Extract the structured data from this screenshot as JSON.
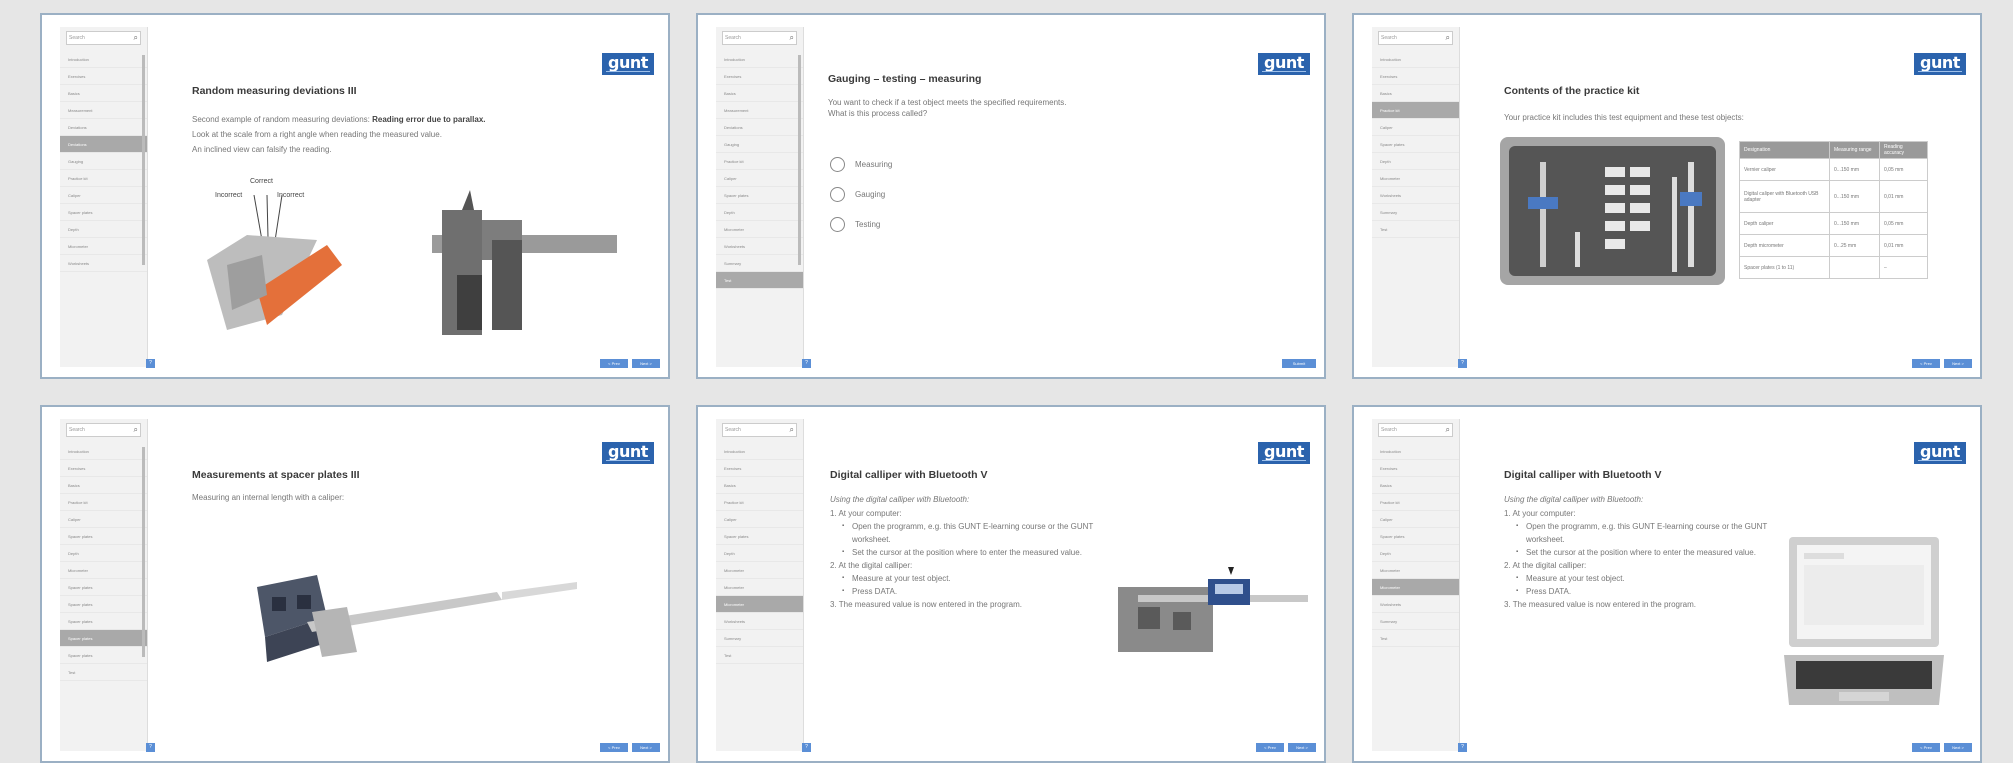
{
  "nav": {
    "search_placeholder": "Search",
    "items": [
      "Introduction",
      "Exercises",
      "Basics",
      "Measurement",
      "Deviations",
      "Gauging",
      "Practice kit",
      "Caliper",
      "Spacer plates",
      "Depth",
      "Micrometer",
      "Worksheets",
      "Summary",
      "Test"
    ]
  },
  "buttons": {
    "prev": "< Prev",
    "next": "Next >",
    "submit": "Submit",
    "help": "?"
  },
  "brand": "gunt",
  "panel1": {
    "title": "Random measuring deviations III",
    "line1_plain": "Second example of random measuring deviations:",
    "line1_bold": "Reading error due to parallax.",
    "line2": "Look at the scale from a right angle when reading the measured value.",
    "line3": "An inclined view can falsify the reading.",
    "label_correct": "Correct",
    "label_incorrect_left": "Incorrect",
    "label_incorrect_right": "Incorrect"
  },
  "panel2": {
    "title": "Gauging – testing – measuring",
    "question_line1": "You want to check if a test object meets the specified requirements.",
    "question_line2": "What is this process called?",
    "options": [
      "Measuring",
      "Gauging",
      "Testing"
    ]
  },
  "panel3": {
    "title": "Contents of the practice kit",
    "intro": "Your practice kit includes this test equipment and these test objects:",
    "table": {
      "headers": [
        "Designation",
        "Measuring range",
        "Reading accuracy"
      ],
      "rows": [
        [
          "Vernier caliper",
          "0...150 mm",
          "0,05 mm"
        ],
        [
          "Digital caliper with Bluetooth USB adapter",
          "0...150 mm",
          "0,01 mm"
        ],
        [
          "Depth caliper",
          "0...150 mm",
          "0,05 mm"
        ],
        [
          "Depth micrometer",
          "0...25 mm",
          "0,01 mm"
        ],
        [
          "Spacer plates (1 to 11)",
          "",
          "–"
        ]
      ]
    }
  },
  "panel4": {
    "title": "Measurements at spacer plates III",
    "text": "Measuring an internal length with a caliper:"
  },
  "panel5": {
    "title": "Digital calliper with Bluetooth V",
    "intro": "Using the digital calliper with Bluetooth:",
    "steps": [
      {
        "text": "1.  At your computer:",
        "sub": false
      },
      {
        "text": "Open the programm, e.g. this GUNT E-learning course or the GUNT worksheet.",
        "sub": true
      },
      {
        "text": "Set the cursor at the position where to enter the measured value.",
        "sub": true
      },
      {
        "text": "2.  At the digital calliper:",
        "sub": false
      },
      {
        "text": "Measure at your test object.",
        "sub": true
      },
      {
        "text": "Press DATA.",
        "sub": true
      },
      {
        "text": "3.  The measured value is now entered in the program.",
        "sub": false
      }
    ]
  },
  "panel6": {
    "title": "Digital calliper with Bluetooth V",
    "intro": "Using the digital calliper with Bluetooth:"
  }
}
